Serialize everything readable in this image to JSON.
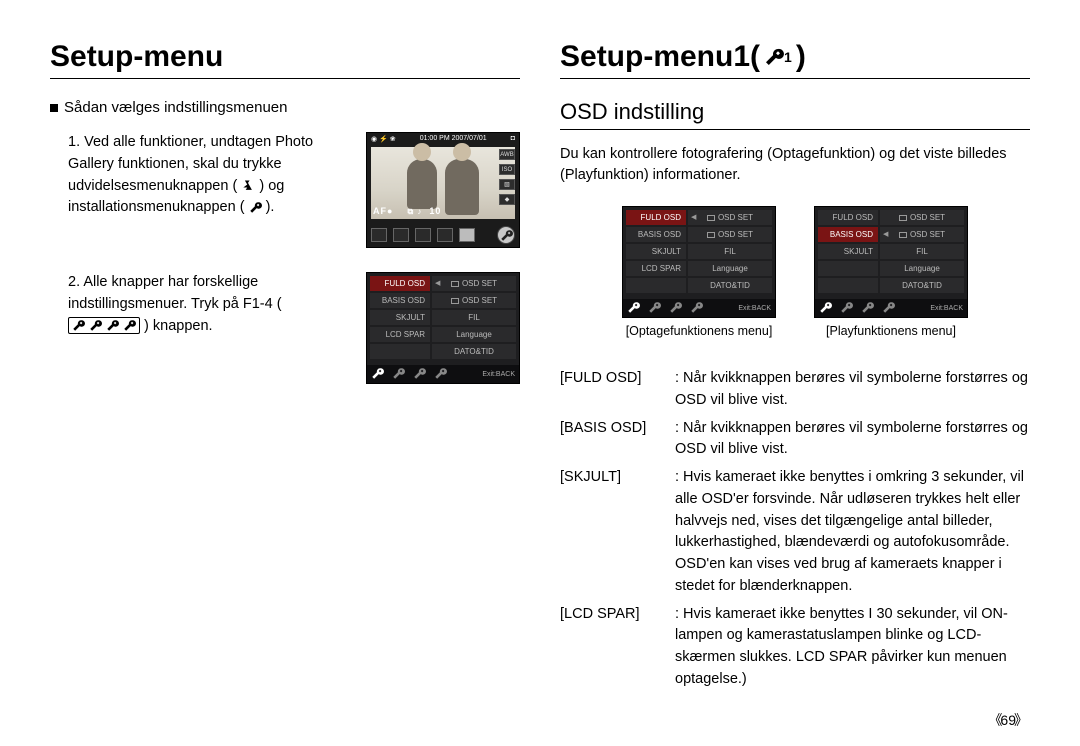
{
  "left": {
    "title": "Setup-menu",
    "section_heading": "Sådan vælges indstillingsmenuen",
    "step1_a": "1. Ved alle funktioner, undtagen Photo Gallery funktionen, skal du trykke udvidelsesmenuknappen (",
    "step1_b": ") og installationsmenuknappen (",
    "step1_c": ").",
    "step2_a": "2. Alle knapper har forskellige indstillingsmenuer. Tryk på F1-4 (",
    "step2_b": ") knappen.",
    "preview": {
      "timestamp": "01:00 PM 2007/07/01",
      "awb": "AWB",
      "iso": "ISO",
      "af_label": "AF●",
      "count": "10"
    },
    "menu": {
      "rows": [
        {
          "left": "FULD OSD",
          "right": "OSD SET",
          "cam": true,
          "selected": true
        },
        {
          "left": "BASIS OSD",
          "right": "OSD SET",
          "cam": true
        },
        {
          "left": "SKJULT",
          "right": "FIL"
        },
        {
          "left": "LCD SPAR",
          "right": "Language"
        },
        {
          "left": "",
          "right": "DATO&TID"
        }
      ],
      "exit": "Exit:BACK"
    }
  },
  "right": {
    "title_a": "Setup-menu1(",
    "title_b": ")",
    "subheading": "OSD indstilling",
    "intro": "Du kan kontrollere fotografering (Optagefunktion) og det viste billedes (Playfunktion) informationer.",
    "menu_rec": {
      "rows": [
        {
          "left": "FULD OSD",
          "right": "OSD SET",
          "cam": true,
          "selected": true
        },
        {
          "left": "BASIS OSD",
          "right": "OSD SET",
          "cam": true
        },
        {
          "left": "SKJULT",
          "right": "FIL"
        },
        {
          "left": "LCD SPAR",
          "right": "Language"
        },
        {
          "left": "",
          "right": "DATO&TID"
        }
      ],
      "exit": "Exit:BACK",
      "caption": "[Optagefunktionens menu]"
    },
    "menu_play": {
      "rows": [
        {
          "left": "FULD OSD",
          "right": "OSD SET",
          "cam": true
        },
        {
          "left": "BASIS OSD",
          "right": "OSD SET",
          "cam": true,
          "selected": true
        },
        {
          "left": "SKJULT",
          "right": "FIL"
        },
        {
          "left": "",
          "right": "Language"
        },
        {
          "left": "",
          "right": "DATO&TID"
        }
      ],
      "exit": "Exit:BACK",
      "caption": "[Playfunktionens menu]"
    },
    "defs": [
      {
        "key": "[FULD OSD]",
        "val": ": Når kvikknappen berøres vil symbolerne forstørres og OSD vil blive vist."
      },
      {
        "key": "[BASIS OSD]",
        "val": ": Når kvikknappen berøres vil symbolerne forstørres og OSD vil blive vist."
      },
      {
        "key": "[SKJULT]",
        "val": ": Hvis kameraet ikke benyttes i omkring 3 sekunder, vil alle OSD'er forsvinde. Når udløseren trykkes helt eller halvvejs ned, vises det tilgængelige antal billeder, lukkerhastighed, blændeværdi og autofokusområde. OSD'en kan vises ved brug af kameraets knapper i stedet for blænderknappen."
      },
      {
        "key": "[LCD SPAR]",
        "val": ": Hvis kameraet ikke benyttes I 30 sekunder, vil ON-lampen og kamerastatuslampen blinke og LCD-skærmen slukkes. LCD SPAR påvirker kun menuen optagelse.)"
      }
    ]
  },
  "page_number": "69"
}
